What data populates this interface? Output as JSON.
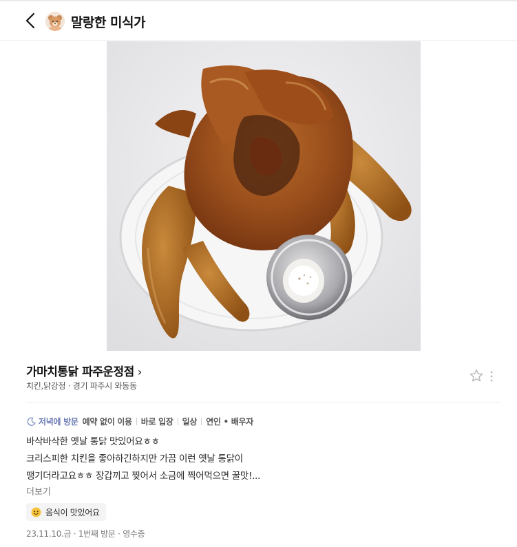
{
  "header": {
    "author_name": "말랑한 미식가"
  },
  "place": {
    "name": "가마치통닭 파주운정점",
    "meta": "치킨,닭강정 · 경기 파주시 와동동"
  },
  "tags": {
    "visit_time": "저녁에 방문",
    "items": [
      "예약 없이 이용",
      "바로 입장",
      "일상",
      "연인 • 배우자"
    ]
  },
  "review": {
    "lines": [
      "바삭바삭한 옛날 통닭 맛있어요ㅎㅎ",
      "크리스피한 치킨을 좋아하긴하지만 가끔 이런 옛날 통닭이",
      "땡기더라고요ㅎㅎ 장갑끼고 찢어서 소금에 찍어먹으면 꿀맛!..."
    ],
    "more_label": "더보기"
  },
  "keyword": {
    "label": "음식이 맛있어요"
  },
  "footer": {
    "info": "23.11.10.금 · 1번째 방문 · 영수증"
  },
  "colors": {
    "visit_tag": "#6b7bb4",
    "keyword_bg": "#f4f4f4",
    "divider": "#ececec"
  }
}
